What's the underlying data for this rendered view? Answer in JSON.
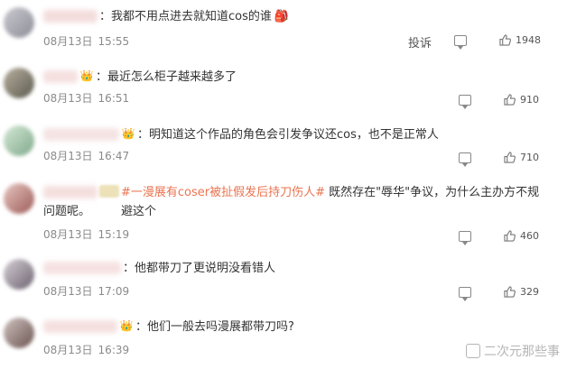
{
  "comments": [
    {
      "text": "：我都不用点进去就知道cos的谁",
      "emoji": "🎒",
      "date": "08月13日",
      "time": "15:55",
      "report_label": "投诉",
      "likes": "1948"
    },
    {
      "text": "：最近怎么柜子越来越多了",
      "badge": "👑",
      "date": "08月13日",
      "time": "16:51",
      "likes": "910"
    },
    {
      "text": "：明知道这个作品的角色会引发争议还cos，也不是正常人",
      "badge": "👑",
      "date": "08月13日",
      "time": "16:47",
      "likes": "710"
    },
    {
      "hashtag": "#一漫展有coser被扯假发后持刀伤人#",
      "text_line1": "既然存在\"辱华\"争议，为什么主办方不规避这个",
      "text_line2": "问题呢。",
      "date": "08月13日",
      "time": "15:19",
      "likes": "460"
    },
    {
      "text": "：他都带刀了更说明没看错人",
      "date": "08月13日",
      "time": "17:09",
      "likes": "329"
    },
    {
      "text": "：他们一般去吗漫展都带刀吗?",
      "badge": "👑",
      "date": "08月13日",
      "time": "16:39",
      "likes": ""
    }
  ],
  "watermark": "二次元那些事"
}
